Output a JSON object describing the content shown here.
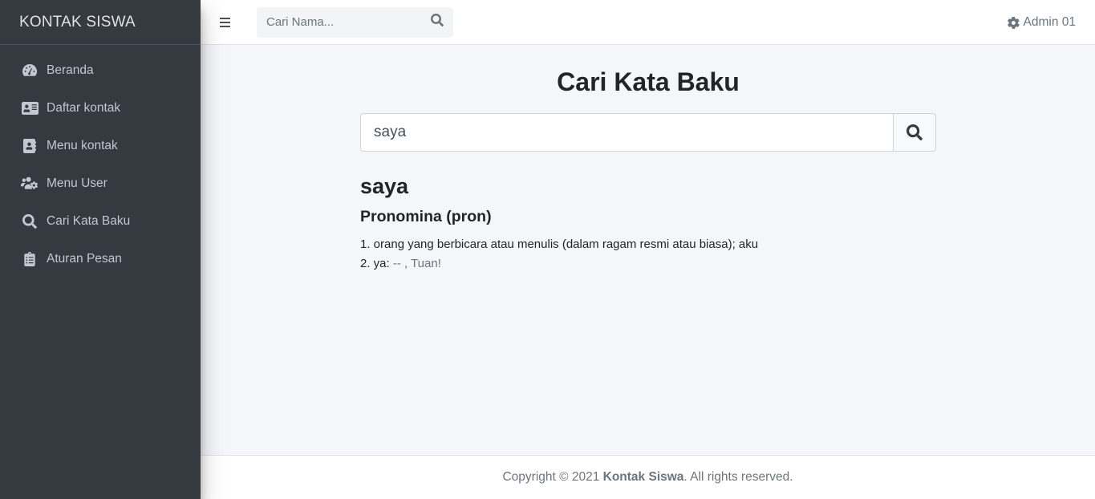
{
  "sidebar": {
    "brand": "KONTAK SISWA",
    "items": [
      {
        "label": "Beranda",
        "icon": "tachometer-icon"
      },
      {
        "label": "Daftar kontak",
        "icon": "address-card-icon"
      },
      {
        "label": "Menu kontak",
        "icon": "address-book-icon"
      },
      {
        "label": "Menu User",
        "icon": "users-cog-icon"
      },
      {
        "label": "Cari Kata Baku",
        "icon": "search-icon"
      },
      {
        "label": "Aturan Pesan",
        "icon": "clipboard-list-icon"
      }
    ]
  },
  "topbar": {
    "search_placeholder": "Cari Nama...",
    "user_label": "Admin 01"
  },
  "main": {
    "title": "Cari Kata Baku",
    "search_value": "saya",
    "word": "saya",
    "part_of_speech": "Pronomina (pron)",
    "definitions": {
      "line1": "1. orang yang berbicara atau menulis (dalam ragam resmi atau biasa); aku",
      "line2_prefix": "2. ya: ",
      "line2_example": "-- , Tuan!"
    }
  },
  "footer": {
    "prefix": "Copyright © 2021 ",
    "brand": "Kontak Siswa",
    "suffix": ". All rights reserved."
  },
  "colors": {
    "sidebar_bg": "#343a40",
    "content_bg": "#f4f6f9",
    "sidebar_text": "#c2c7d0",
    "muted_text": "#6c757d"
  }
}
